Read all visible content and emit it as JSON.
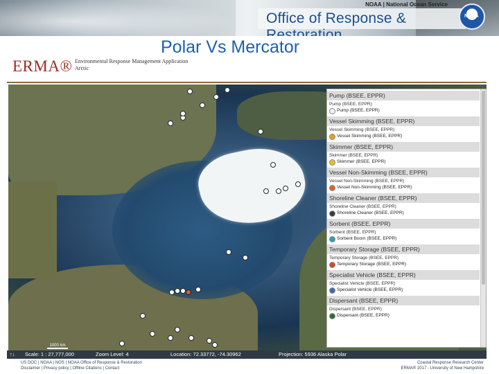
{
  "banner": {
    "agency": "NOAA | National Ocean Service",
    "office": "Office of Response & Restoration",
    "logo_text": "NOAA"
  },
  "slide_title": "Polar Vs Mercator",
  "erma": {
    "logo": "ERMA®",
    "subtitle_line1": "Environmental Response Management Application",
    "subtitle_line2": "Arctic"
  },
  "map": {
    "scalebar_label": "1000 km"
  },
  "legend": {
    "categories": [
      {
        "header": "Pump (BSEE, EPPR)",
        "sub": "Pump (BSEE, EPPR)",
        "item": "Pump (BSEE, EPPR)",
        "icon_color": "#f2f2f2"
      },
      {
        "header": "Vessel Skimming (BSEE, EPPR)",
        "sub": "Vessel Skimming (BSEE, EPPR)",
        "item": "Vessel Skimming (BSEE, EPPR)",
        "icon_color": "#e2a128"
      },
      {
        "header": "Skimmer (BSEE, EPPR)",
        "sub": "Skimmer (BSEE, EPPR)",
        "item": "Skimmer (BSEE, EPPR)",
        "icon_color": "#e6c12e"
      },
      {
        "header": "Vessel Non-Skimming (BSEE, EPPR)",
        "sub": "Vessel Non-Skimming (BSEE, EPPR)",
        "item": "Vessel Non-Skimming (BSEE, EPPR)",
        "icon_color": "#e0602a"
      },
      {
        "header": "Shoreline Cleaner (BSEE, EPPR)",
        "sub": "Shoreline Cleaner (BSEE, EPPR)",
        "item": "Shoreline Cleaner (BSEE, EPPR)",
        "icon_color": "#3b3b3b"
      },
      {
        "header": "Sorbent (BSEE, EPPR)",
        "sub": "Sorbent (BSEE, EPPR)",
        "item": "Sorbent Boom (BSEE, EPPR)",
        "icon_color": "#2b9fb5"
      },
      {
        "header": "Temporary Storage (BSEE, EPPR)",
        "sub": "Temporary Storage (BSEE, EPPR)",
        "item": "Temporary Storage (BSEE, EPPR)",
        "icon_color": "#c94a3a"
      },
      {
        "header": "Specialist Vehicle (BSEE, EPPR)",
        "sub": "Specialist Vehicle (BSEE, EPPR)",
        "item": "Specialist Vehicle (BSEE, EPPR)",
        "icon_color": "#3e6ab0"
      },
      {
        "header": "Dispersant (BSEE, EPPR)",
        "sub": "Dispersant (BSEE, EPPR)",
        "item": "Dispersant (BSEE, EPPR)",
        "icon_color": "#2e6b35"
      }
    ]
  },
  "status": {
    "scale_label": "Scale: 1 : 27,777,000",
    "zoom_label": "Zoom Level: 4",
    "location_label": "Location: 72.33772, -74.30962",
    "projection_label": "Projection: 5936 Alaska Polar"
  },
  "footer": {
    "left_line1": "US DOC | NOAA | NOS | NOAA Office of Response & Restoration",
    "left_line2": "Disclaimer | Privacy policy | Offline Citations | Contact",
    "right_line1": "Coastal Response Research Center",
    "right_line2": "ERMA® 2017 - University of New Hampshire"
  }
}
